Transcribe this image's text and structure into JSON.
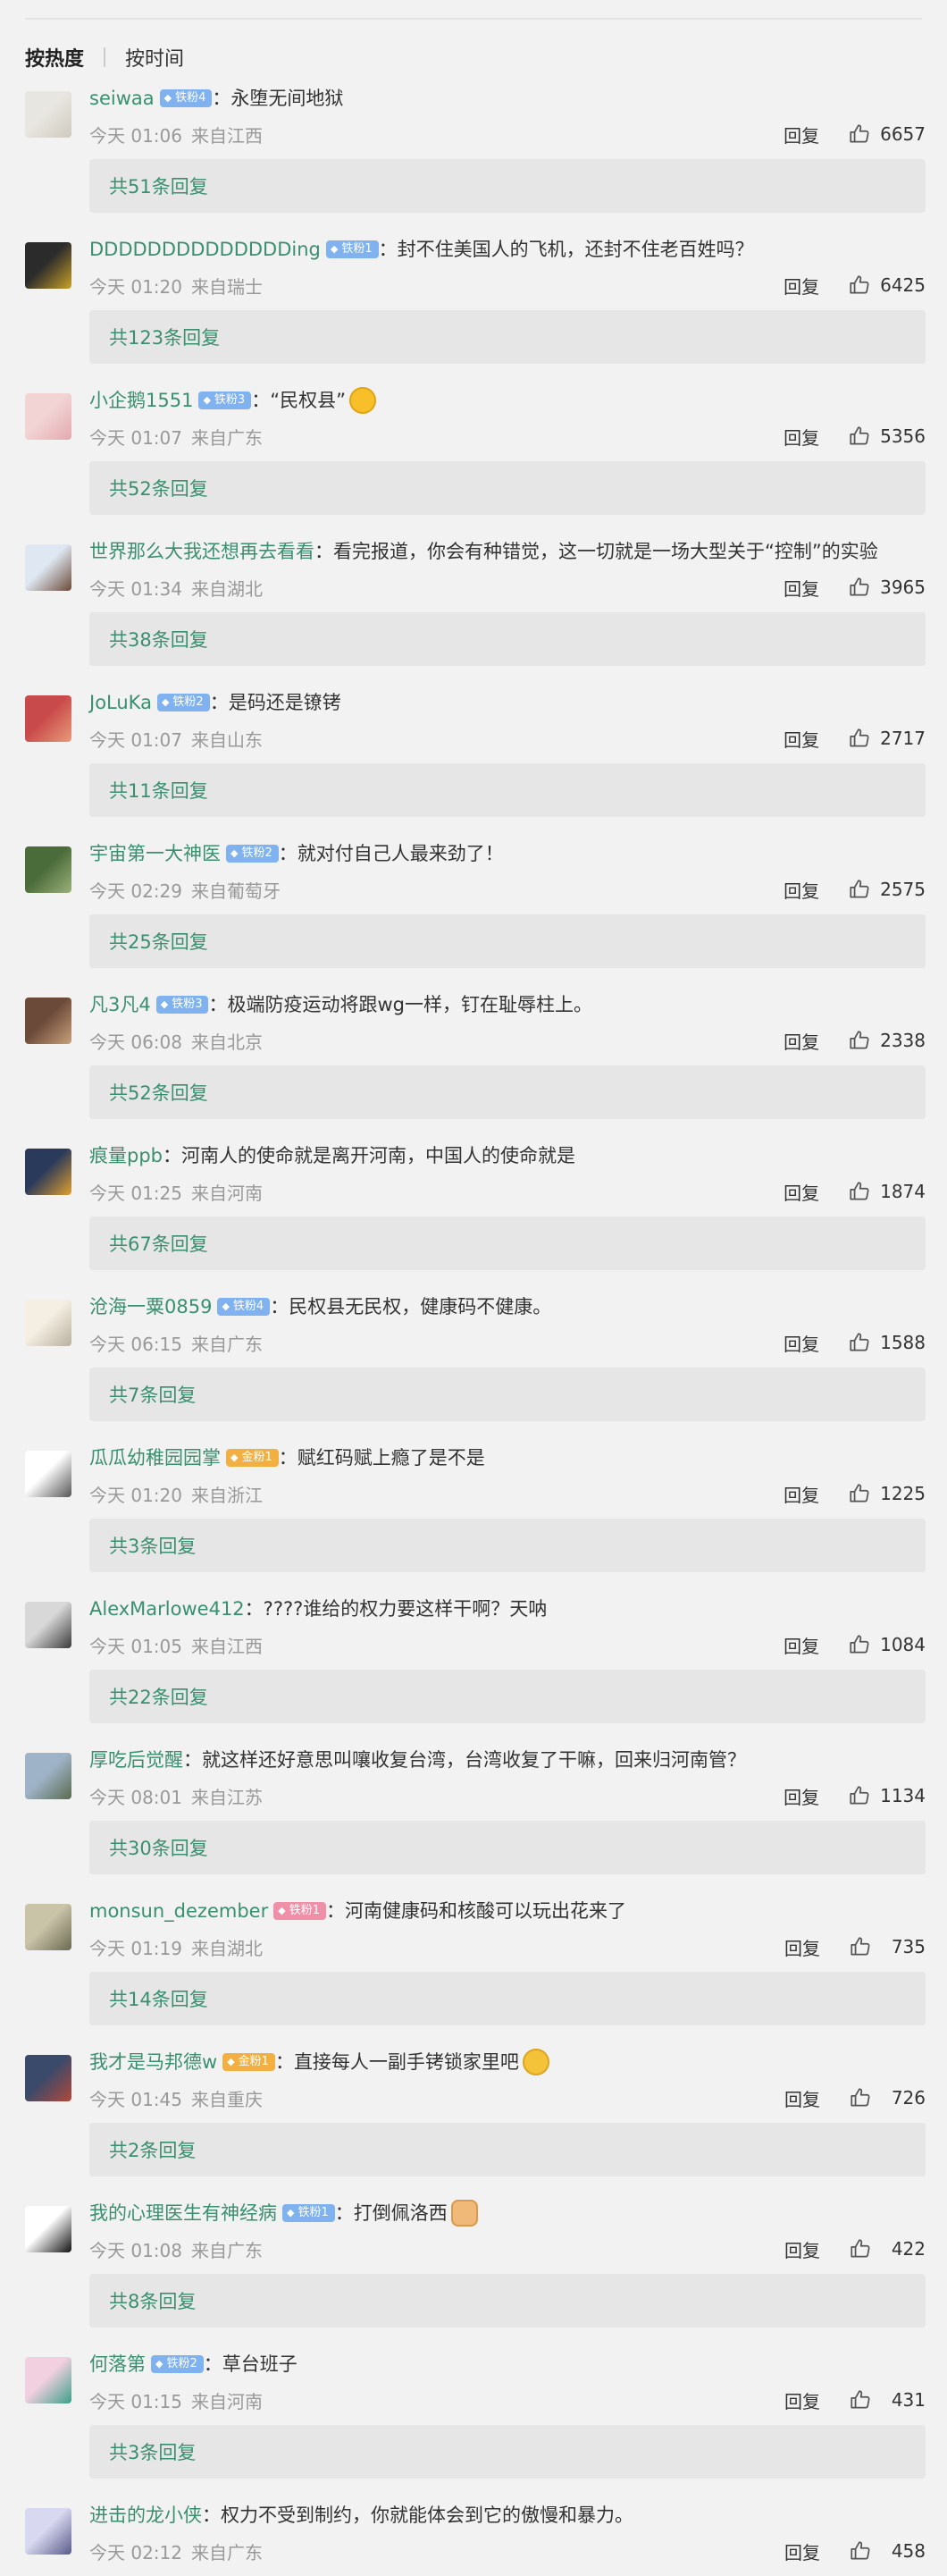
{
  "sort": {
    "hot": "按热度",
    "time": "按时间"
  },
  "ui": {
    "reply": "回复"
  },
  "comments": [
    {
      "user": "seiwaa",
      "badge": "铁粉4",
      "badge_color": "blue",
      "sep": "：",
      "text": "永堕无间地狱",
      "emoji": "",
      "time": "今天 01:06",
      "loc": "来自江西",
      "likes": "6657",
      "replies": "共51条回复",
      "avatar_colors": [
        "#e8e6e0",
        "#cfcac0"
      ]
    },
    {
      "user": "DDDDDDDDDDDDDDing",
      "badge": "铁粉1",
      "badge_color": "blue",
      "sep": "：",
      "text": "封不住美国人的飞机，还封不住老百姓吗？",
      "emoji": "",
      "time": "今天 01:20",
      "loc": "来自瑞士",
      "likes": "6425",
      "replies": "共123条回复",
      "avatar_colors": [
        "#2b2b2b",
        "#c9a227"
      ]
    },
    {
      "user": "小企鹅1551",
      "badge": "铁粉3",
      "badge_color": "blue",
      "sep": "：",
      "text": "“民权县”",
      "emoji": "wow",
      "time": "今天 01:07",
      "loc": "来自广东",
      "likes": "5356",
      "replies": "共52条回复",
      "avatar_colors": [
        "#f2d4d4",
        "#e3a9b0"
      ]
    },
    {
      "user": "世界那么大我还想再去看看",
      "badge": "",
      "badge_color": "",
      "sep": "：",
      "text": "看完报道，你会有种错觉，这一切就是一场大型关于“控制”的实验",
      "emoji": "",
      "time": "今天 01:34",
      "loc": "来自湖北",
      "likes": "3965",
      "replies": "共38条回复",
      "avatar_colors": [
        "#dfe8f2",
        "#6b4a3a"
      ]
    },
    {
      "user": "JoLuKa",
      "badge": "铁粉2",
      "badge_color": "blue",
      "sep": "：",
      "text": "是码还是镣铐",
      "emoji": "",
      "time": "今天 01:07",
      "loc": "来自山东",
      "likes": "2717",
      "replies": "共11条回复",
      "avatar_colors": [
        "#c94a4a",
        "#e89a7a"
      ]
    },
    {
      "user": "宇宙第一大神医",
      "badge": "铁粉2",
      "badge_color": "blue",
      "sep": "：",
      "text": "就对付自己人最来劲了！",
      "emoji": "",
      "time": "今天 02:29",
      "loc": "来自葡萄牙",
      "likes": "2575",
      "replies": "共25条回复",
      "avatar_colors": [
        "#4a6b3a",
        "#9bb07a"
      ]
    },
    {
      "user": "凡3凡4",
      "badge": "铁粉3",
      "badge_color": "blue",
      "sep": "：",
      "text": "极端防疫运动将跟wg一样，钉在耻辱柱上。",
      "emoji": "",
      "time": "今天 06:08",
      "loc": "来自北京",
      "likes": "2338",
      "replies": "共52条回复",
      "avatar_colors": [
        "#6b4a3a",
        "#c9a07a"
      ]
    },
    {
      "user": "痕量ppb",
      "badge": "",
      "badge_color": "",
      "sep": "：",
      "text": "河南人的使命就是离开河南，中国人的使命就是",
      "emoji": "",
      "time": "今天 01:25",
      "loc": "来自河南",
      "likes": "1874",
      "replies": "共67条回复",
      "avatar_colors": [
        "#2a3a5a",
        "#e0a030"
      ]
    },
    {
      "user": "沧海一粟0859",
      "badge": "铁粉4",
      "badge_color": "blue",
      "sep": "：",
      "text": "民权县无民权，健康码不健康。",
      "emoji": "",
      "time": "今天 06:15",
      "loc": "来自广东",
      "likes": "1588",
      "replies": "共7条回复",
      "avatar_colors": [
        "#f4efe2",
        "#b8b0a0"
      ]
    },
    {
      "user": "瓜瓜幼稚园园掌",
      "badge": "金粉1",
      "badge_color": "gold",
      "sep": "：",
      "text": "赋红码赋上瘾了是不是",
      "emoji": "",
      "time": "今天 01:20",
      "loc": "来自浙江",
      "likes": "1225",
      "replies": "共3条回复",
      "avatar_colors": [
        "#ffffff",
        "#555555"
      ]
    },
    {
      "user": "AlexMarlowe412",
      "badge": "",
      "badge_color": "",
      "sep": "：",
      "text": "????谁给的权力要这样干啊？天呐",
      "emoji": "",
      "time": "今天 01:05",
      "loc": "来自江西",
      "likes": "1084",
      "replies": "共22条回复",
      "avatar_colors": [
        "#d8d8d8",
        "#3a3a3a"
      ]
    },
    {
      "user": "厚吃后觉醒",
      "badge": "",
      "badge_color": "",
      "sep": "：",
      "text": "就这样还好意思叫嚷收复台湾，台湾收复了干嘛，回来归河南管？",
      "emoji": "",
      "time": "今天 08:01",
      "loc": "来自江苏",
      "likes": "1134",
      "replies": "共30条回复",
      "avatar_colors": [
        "#9fb3c8",
        "#5a6a50"
      ]
    },
    {
      "user": "monsun_dezember",
      "badge": "铁粉1",
      "badge_color": "pink",
      "sep": "：",
      "text": "河南健康码和核酸可以玩出花来了",
      "emoji": "",
      "time": "今天 01:19",
      "loc": "来自湖北",
      "likes": "735",
      "replies": "共14条回复",
      "avatar_colors": [
        "#c9c3a8",
        "#6a6a50"
      ]
    },
    {
      "user": "我才是马邦德w",
      "badge": "金粉1",
      "badge_color": "gold",
      "sep": "：",
      "text": "直接每人一副手铐锁家里吧",
      "emoji": "smug",
      "time": "今天 01:45",
      "loc": "来自重庆",
      "likes": "726",
      "replies": "共2条回复",
      "avatar_colors": [
        "#3a4a6a",
        "#b04a3a"
      ]
    },
    {
      "user": "我的心理医生有神经病",
      "badge": "铁粉1",
      "badge_color": "blue",
      "sep": "：",
      "text": "打倒佩洛西",
      "emoji": "fist",
      "time": "今天 01:08",
      "loc": "来自广东",
      "likes": "422",
      "replies": "共8条回复",
      "avatar_colors": [
        "#ffffff",
        "#111111"
      ]
    },
    {
      "user": "何落第",
      "badge": "铁粉2",
      "badge_color": "blue",
      "sep": "：",
      "text": "草台班子",
      "emoji": "",
      "time": "今天 01:15",
      "loc": "来自河南",
      "likes": "431",
      "replies": "共3条回复",
      "avatar_colors": [
        "#f3d0e0",
        "#3aa08a"
      ]
    },
    {
      "user": "进击的龙小侠",
      "badge": "",
      "badge_color": "",
      "sep": "：",
      "text": "权力不受到制约，你就能体会到它的傲慢和暴力。",
      "emoji": "",
      "time": "今天 02:12",
      "loc": "来自广东",
      "likes": "458",
      "replies": "",
      "avatar_colors": [
        "#d8d8f0",
        "#5a5a8a"
      ]
    }
  ]
}
